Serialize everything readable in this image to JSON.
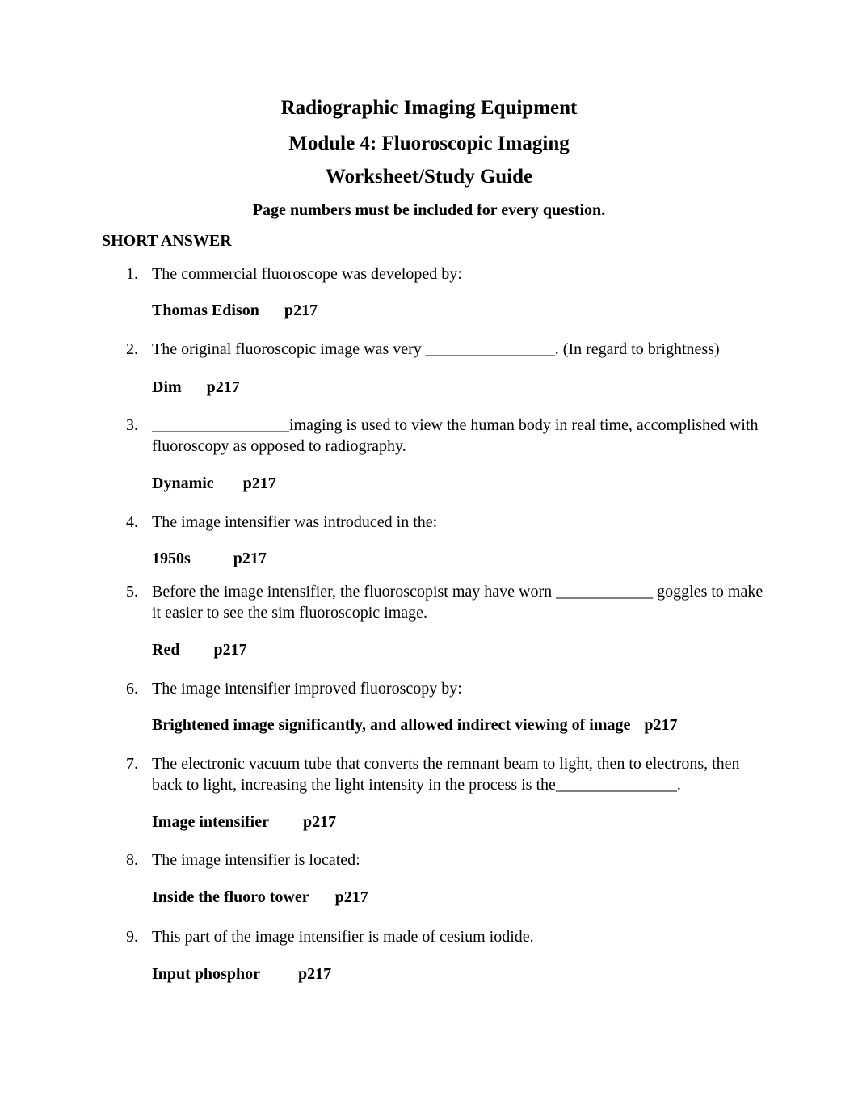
{
  "header": {
    "course_title": "Radiographic Imaging Equipment",
    "module_title": "Module 4: Fluoroscopic Imaging",
    "doc_type": "Worksheet/Study Guide",
    "instruction": "Page numbers must be included for every question."
  },
  "section_title": "SHORT ANSWER",
  "questions": [
    {
      "num": "1.",
      "text": "The commercial fluoroscope was developed by:",
      "answer": "Thomas Edison",
      "page": "p217"
    },
    {
      "num": "2.",
      "text": "The original fluoroscopic image was very ________________. (In regard to brightness)",
      "answer": "Dim",
      "page": "p217"
    },
    {
      "num": "3.",
      "text": "_________________imaging is used to view the human body in real time, accomplished with fluoroscopy as opposed to radiography.",
      "answer": "Dynamic",
      "page": "p217"
    },
    {
      "num": "4.",
      "text": "The image intensifier was introduced in the:",
      "answer": "1950s",
      "page": "p217"
    },
    {
      "num": "5.",
      "text": "Before the image intensifier, the fluoroscopist may have worn ____________ goggles to make it easier to see the sim fluoroscopic image.",
      "answer": "Red",
      "page": "p217"
    },
    {
      "num": "6.",
      "text": "The image intensifier improved fluoroscopy by:",
      "answer": "Brightened image significantly, and allowed indirect viewing of image",
      "page": "p217"
    },
    {
      "num": "7.",
      "text": "The electronic vacuum tube that converts the remnant beam to light, then to electrons, then back to light, increasing the light intensity in the process is the_______________.",
      "answer": "Image intensifier",
      "page": "p217"
    },
    {
      "num": "8.",
      "text": "The image intensifier is located:",
      "answer": "Inside the fluoro tower",
      "page": "p217"
    },
    {
      "num": "9.",
      "text": "This part of the image intensifier is made of cesium iodide.",
      "answer": "Input phosphor",
      "page": "p217"
    }
  ]
}
